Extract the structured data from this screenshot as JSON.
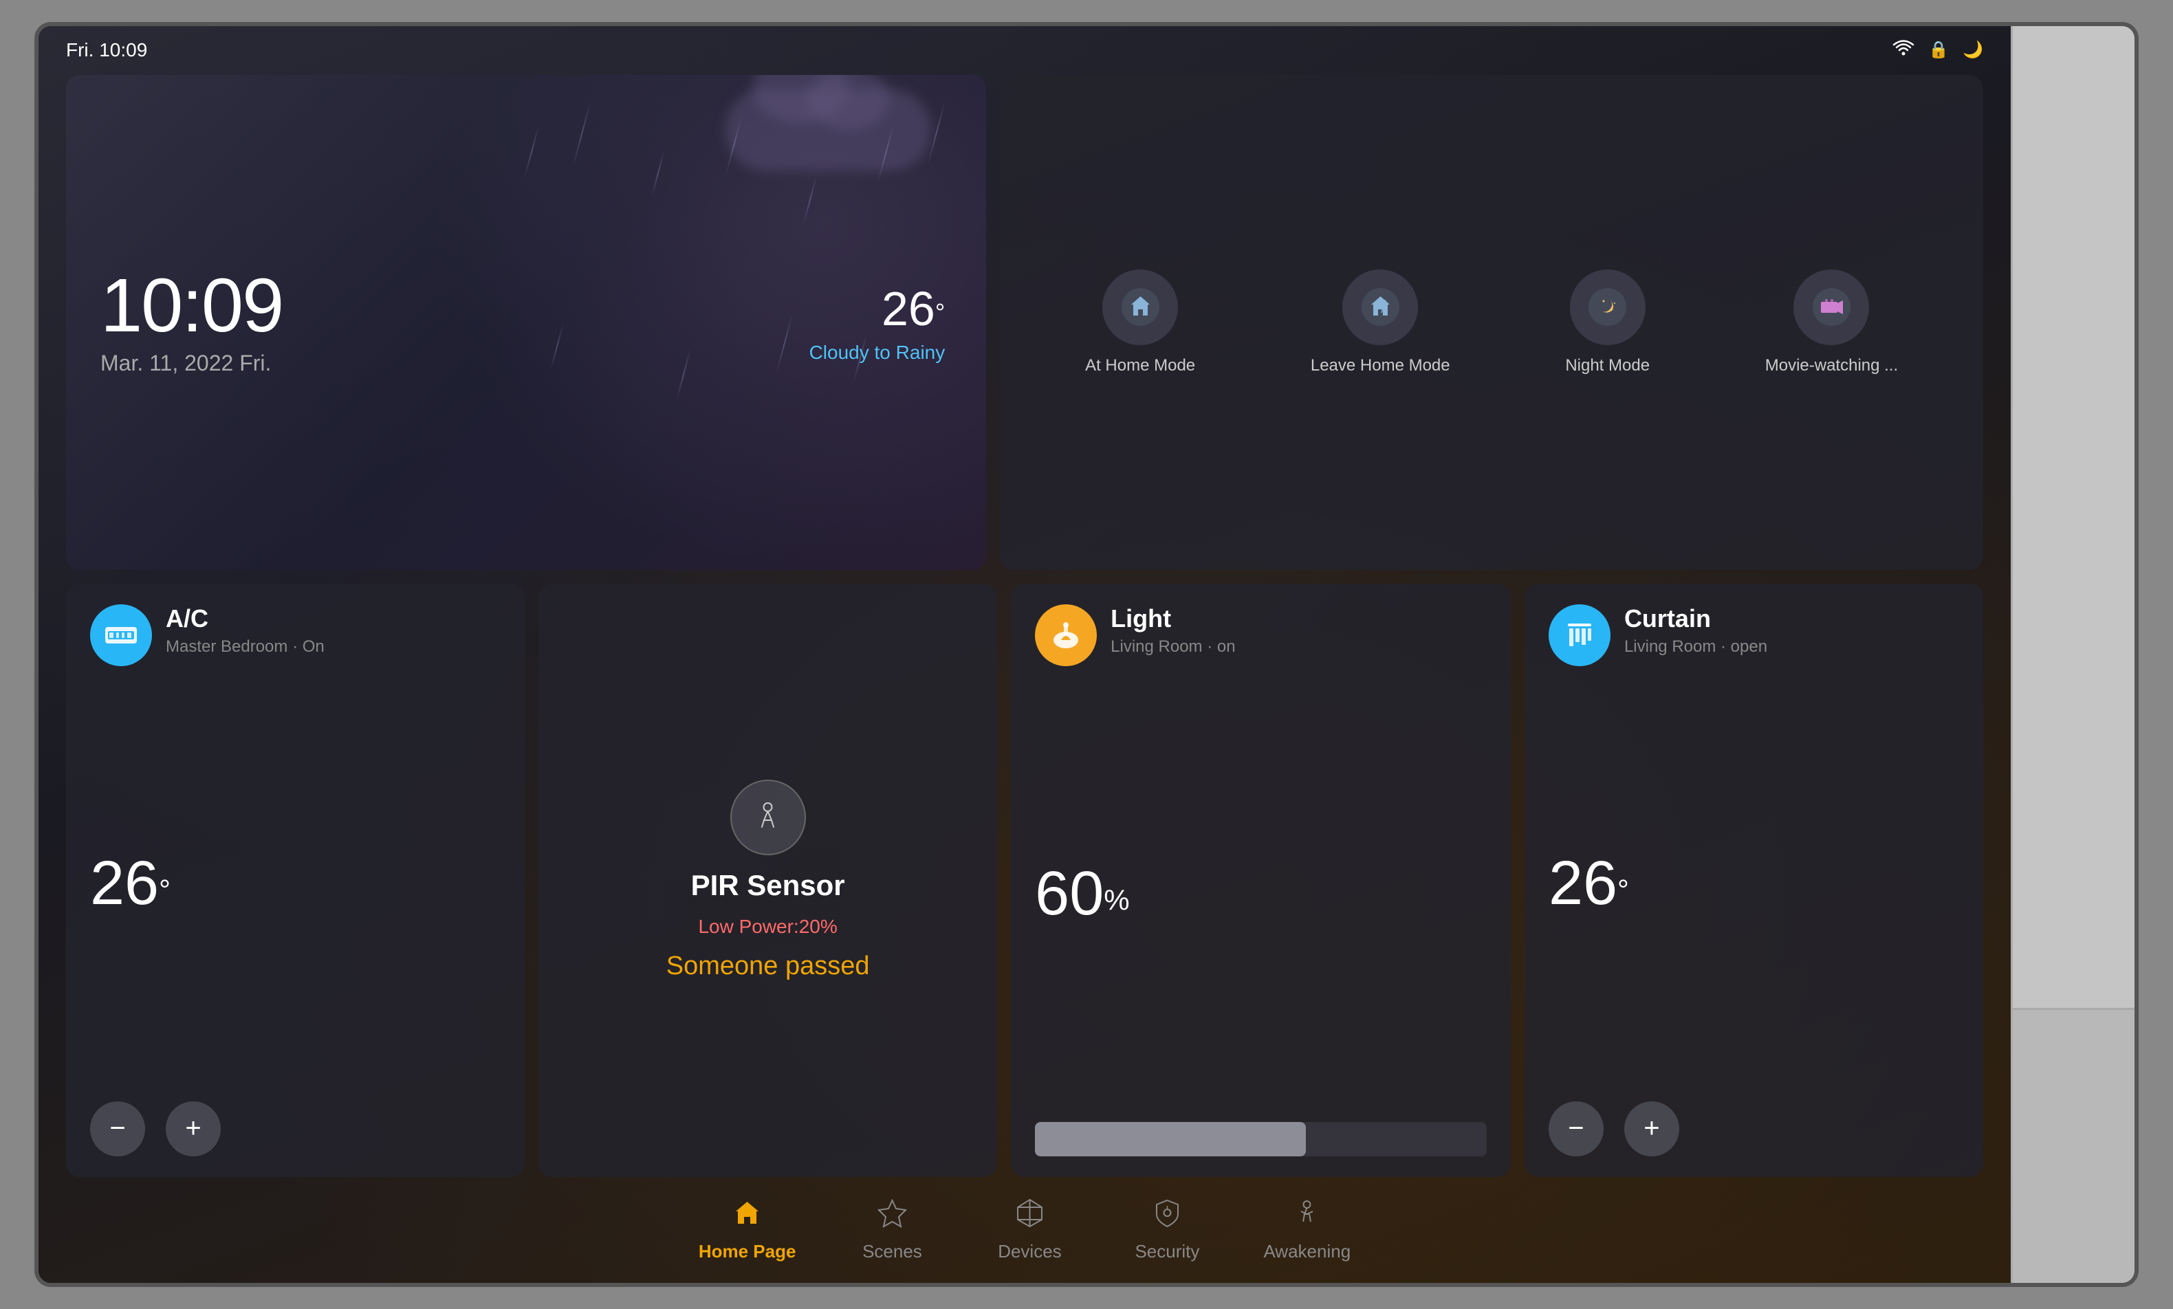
{
  "statusBar": {
    "time": "Fri. 10:09"
  },
  "weather": {
    "time": "10:09",
    "date": "Mar. 11, 2022  Fri.",
    "temperature": "26",
    "tempUnit": "°",
    "description": "Cloudy to Rainy"
  },
  "scenes": [
    {
      "id": "at-home",
      "label": "At Home Mode",
      "icon": "🏠"
    },
    {
      "id": "leave-home",
      "label": "Leave Home Mode",
      "icon": "🚶"
    },
    {
      "id": "night",
      "label": "Night Mode",
      "icon": "🌙"
    },
    {
      "id": "movie",
      "label": "Movie-watching ...",
      "icon": "🎬"
    }
  ],
  "devices": {
    "ac": {
      "name": "A/C",
      "subtitle": "Master Bedroom · On",
      "value": "26",
      "unit": "°",
      "icon": "❄"
    },
    "pir": {
      "name": "PIR Sensor",
      "powerAlert": "Low Power:20%",
      "status": "Someone passed"
    },
    "light": {
      "name": "Light",
      "subtitle": "Living Room · on",
      "value": "60",
      "unit": "%",
      "brightness": 60,
      "icon": "💡"
    },
    "curtain": {
      "name": "Curtain",
      "subtitle": "Living Room · open",
      "value": "26",
      "unit": "°",
      "icon": "🪟"
    }
  },
  "nav": [
    {
      "id": "home",
      "label": "Home Page",
      "active": true,
      "icon": "⌂"
    },
    {
      "id": "scenes",
      "label": "Scenes",
      "active": false,
      "icon": "⬡"
    },
    {
      "id": "devices",
      "label": "Devices",
      "active": false,
      "icon": "⬡"
    },
    {
      "id": "security",
      "label": "Security",
      "active": false,
      "icon": "⬡"
    },
    {
      "id": "awakening",
      "label": "Awakening",
      "active": false,
      "icon": "🚶"
    }
  ]
}
